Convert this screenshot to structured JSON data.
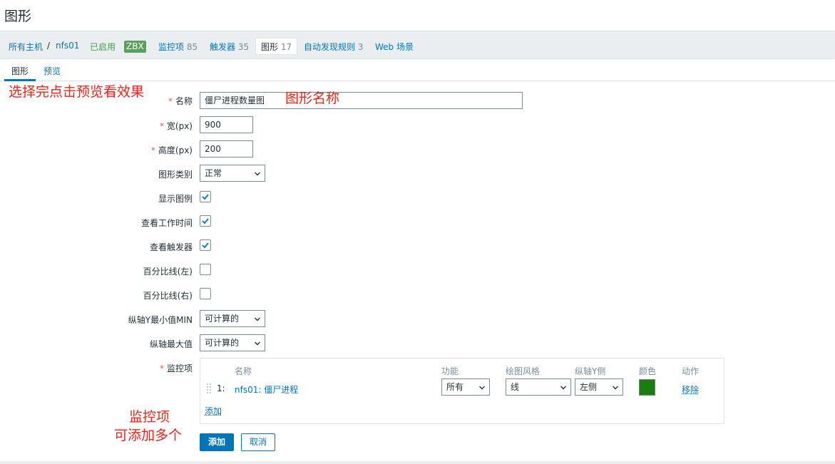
{
  "page": {
    "title": "图形"
  },
  "breadcrumb": {
    "all_hosts": "所有主机",
    "separator": "/",
    "host": "nfs01",
    "status": "已启用",
    "zbx_badge": "ZBX",
    "items_label": "监控项",
    "items_count": "85",
    "triggers_label": "触发器",
    "triggers_count": "35",
    "graphs_label": "图形",
    "graphs_count": "17",
    "discovery_label": "自动发现规则",
    "discovery_count": "3",
    "web_label": "Web 场景"
  },
  "tabs": {
    "graph": "图形",
    "preview": "预览"
  },
  "form": {
    "name_label": "名称",
    "name_value": "僵尸进程数量图",
    "width_label": "宽(px)",
    "width_value": "900",
    "height_label": "高度(px)",
    "height_value": "200",
    "graph_type_label": "图形类别",
    "graph_type_value": "正常",
    "show_legend_label": "显示图例",
    "show_legend": true,
    "working_time_label": "查看工作时间",
    "working_time": true,
    "triggers_label": "查看触发器",
    "triggers": true,
    "percentile_left_label": "百分比线(左)",
    "percentile_left": false,
    "percentile_right_label": "百分比线(右)",
    "percentile_right": false,
    "ymin_label": "纵轴Y最小值MIN",
    "ymin_value": "可计算的",
    "ymax_label": "纵轴最大值",
    "ymax_value": "可计算的",
    "items_label": "监控项",
    "required_mark": "*"
  },
  "items_table": {
    "headers": {
      "name": "名称",
      "function": "功能",
      "draw_style": "绘图风格",
      "y_axis_side": "纵轴Y侧",
      "color": "颜色",
      "action": "动作"
    },
    "rows": [
      {
        "num": "1:",
        "name": "nfs01: 僵尸进程",
        "function": "所有",
        "draw_style": "线",
        "y_axis_side": "左侧",
        "color": "#1A7C11",
        "action": "移除"
      }
    ],
    "add_link": "添加"
  },
  "buttons": {
    "add": "添加",
    "cancel": "取消"
  },
  "annotations": {
    "preview_hint": "选择完点击预览看效果",
    "graph_name_hint": "图形名称",
    "items_hint_line1": "监控项",
    "items_hint_line2": "可添加多个"
  },
  "colors": {
    "link": "#0275b8",
    "primary": "#0275b8",
    "enabled": "#429e47",
    "badge": "#59a05c",
    "annotation": "#e8231a",
    "swatch": "#1a7c11"
  }
}
